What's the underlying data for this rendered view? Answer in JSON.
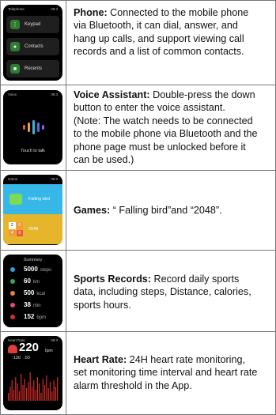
{
  "features": [
    {
      "id": "phone",
      "title": "Phone:",
      "lines": [
        " Connected to the mobile phone",
        "via Bluetooth, it can dial, answer, and",
        "hang up calls,  and support viewing call",
        "records and a list of common contacts."
      ],
      "screen": {
        "app": "Telephone",
        "items": [
          {
            "label": "Keypad",
            "icon": "keypad-icon",
            "color": "#2e7d32"
          },
          {
            "label": "Contacts",
            "icon": "contact-icon",
            "color": "#2e7d32"
          },
          {
            "label": "Recents",
            "icon": "call-log-icon",
            "color": "#2e7d32"
          }
        ]
      }
    },
    {
      "id": "voice",
      "title": "Voice Assistant:",
      "lines": [
        " Double-press the down",
        "button to enter the voice assistant.",
        "(Note: The watch needs to be connected",
        "to the mobile phone via Bluetooth and the",
        "phone page must be unlocked before it",
        "can be used.)"
      ],
      "screen": {
        "app": "Voice",
        "prompt": "Touch to talk"
      }
    },
    {
      "id": "games",
      "title": "Games:",
      "lines": [
        " “ Falling bird”and “2048”."
      ],
      "screen": {
        "app": "Game",
        "items": [
          "Falling bird",
          "2048"
        ]
      }
    },
    {
      "id": "sports",
      "title": "Sports Records:",
      "lines": [
        " Record daily sports",
        "data, including steps, Distance, calories,",
        "sports hours."
      ],
      "screen": {
        "title": "Summary",
        "stats": [
          {
            "value": "5000",
            "unit": "steps",
            "color": "#2e9bd6"
          },
          {
            "value": "60",
            "unit": "km",
            "color": "#3aa655"
          },
          {
            "value": "500",
            "unit": "kcal",
            "color": "#e6862a"
          },
          {
            "value": "38",
            "unit": "min",
            "color": "#e04a7a"
          },
          {
            "value": "152",
            "unit": "bpm",
            "color": "#d92b2b"
          }
        ]
      }
    },
    {
      "id": "heart",
      "title": "Heart Rate:",
      "lines": [
        " 24H heart rate monitoring,",
        "set monitoring time interval and heart rate",
        "alarm threshold in the App."
      ],
      "screen": {
        "app": "Heart Rate",
        "value": "220",
        "unit": "bpm",
        "max": "130",
        "min": "50"
      }
    }
  ]
}
